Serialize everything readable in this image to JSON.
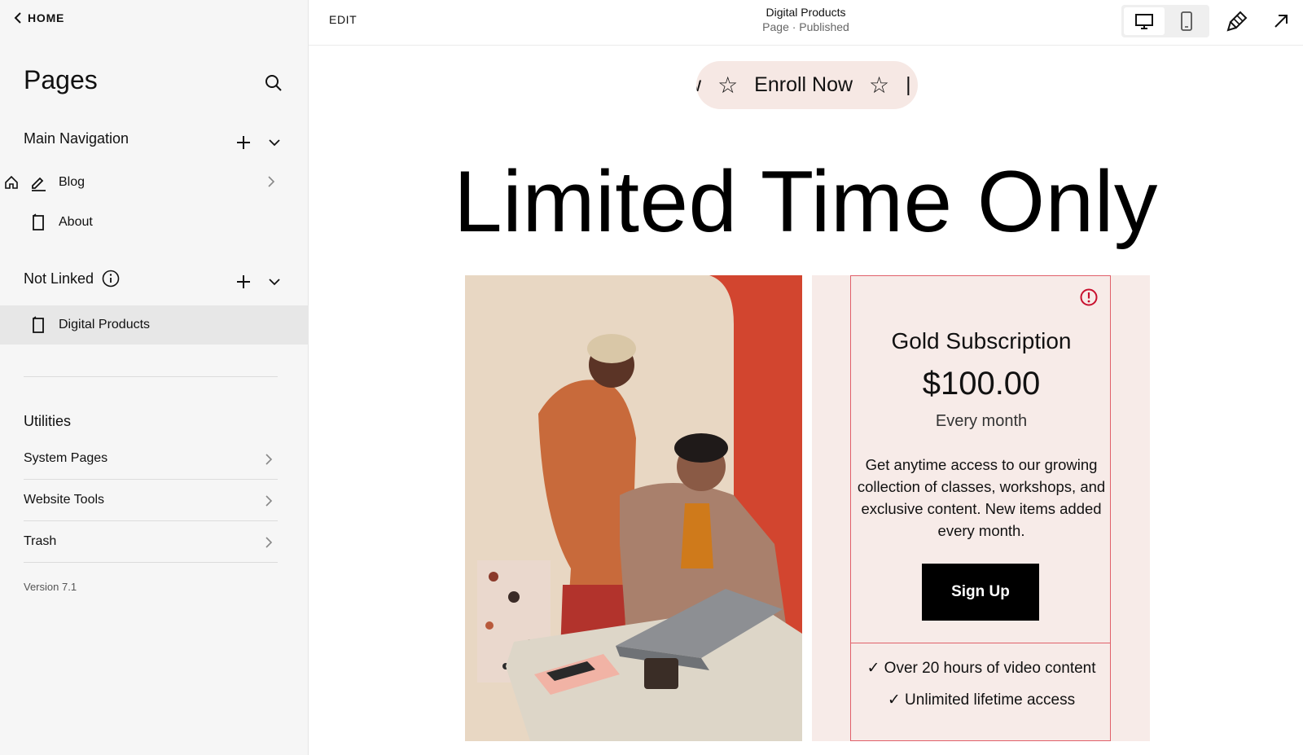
{
  "sidebar": {
    "home_label": "HOME",
    "title": "Pages",
    "main_nav": {
      "label": "Main Navigation",
      "items": [
        {
          "label": "Blog",
          "icon": "blog-pen-icon"
        },
        {
          "label": "About",
          "icon": "page-icon"
        }
      ]
    },
    "not_linked": {
      "label": "Not Linked",
      "items": [
        {
          "label": "Digital Products",
          "icon": "page-icon"
        }
      ]
    },
    "utilities": {
      "label": "Utilities",
      "items": [
        {
          "label": "System Pages"
        },
        {
          "label": "Website Tools"
        },
        {
          "label": "Trash"
        }
      ]
    },
    "version": "Version 7.1"
  },
  "topbar": {
    "edit_label": "EDIT",
    "page_title": "Digital Products",
    "page_status": "Page · Published"
  },
  "canvas": {
    "marquee_text": "Enroll Now",
    "marquee_prefix": "w",
    "hero_title": "Limited Time Only",
    "product": {
      "name": "Gold Subscription",
      "price": "$100.00",
      "period": "Every month",
      "description": "Get anytime access to our growing collection of classes, workshops, and exclusive content. New items added every month.",
      "button_label": "Sign Up",
      "features": [
        "✓ Over 20 hours of video content",
        "✓ Unlimited lifetime access"
      ]
    }
  },
  "colors": {
    "sidebar_bg": "#f6f6f6",
    "active_row": "#e7e7e7",
    "product_panel_bg": "#f7ebe8",
    "card_border": "#e0606a",
    "alert": "#c8102e"
  }
}
